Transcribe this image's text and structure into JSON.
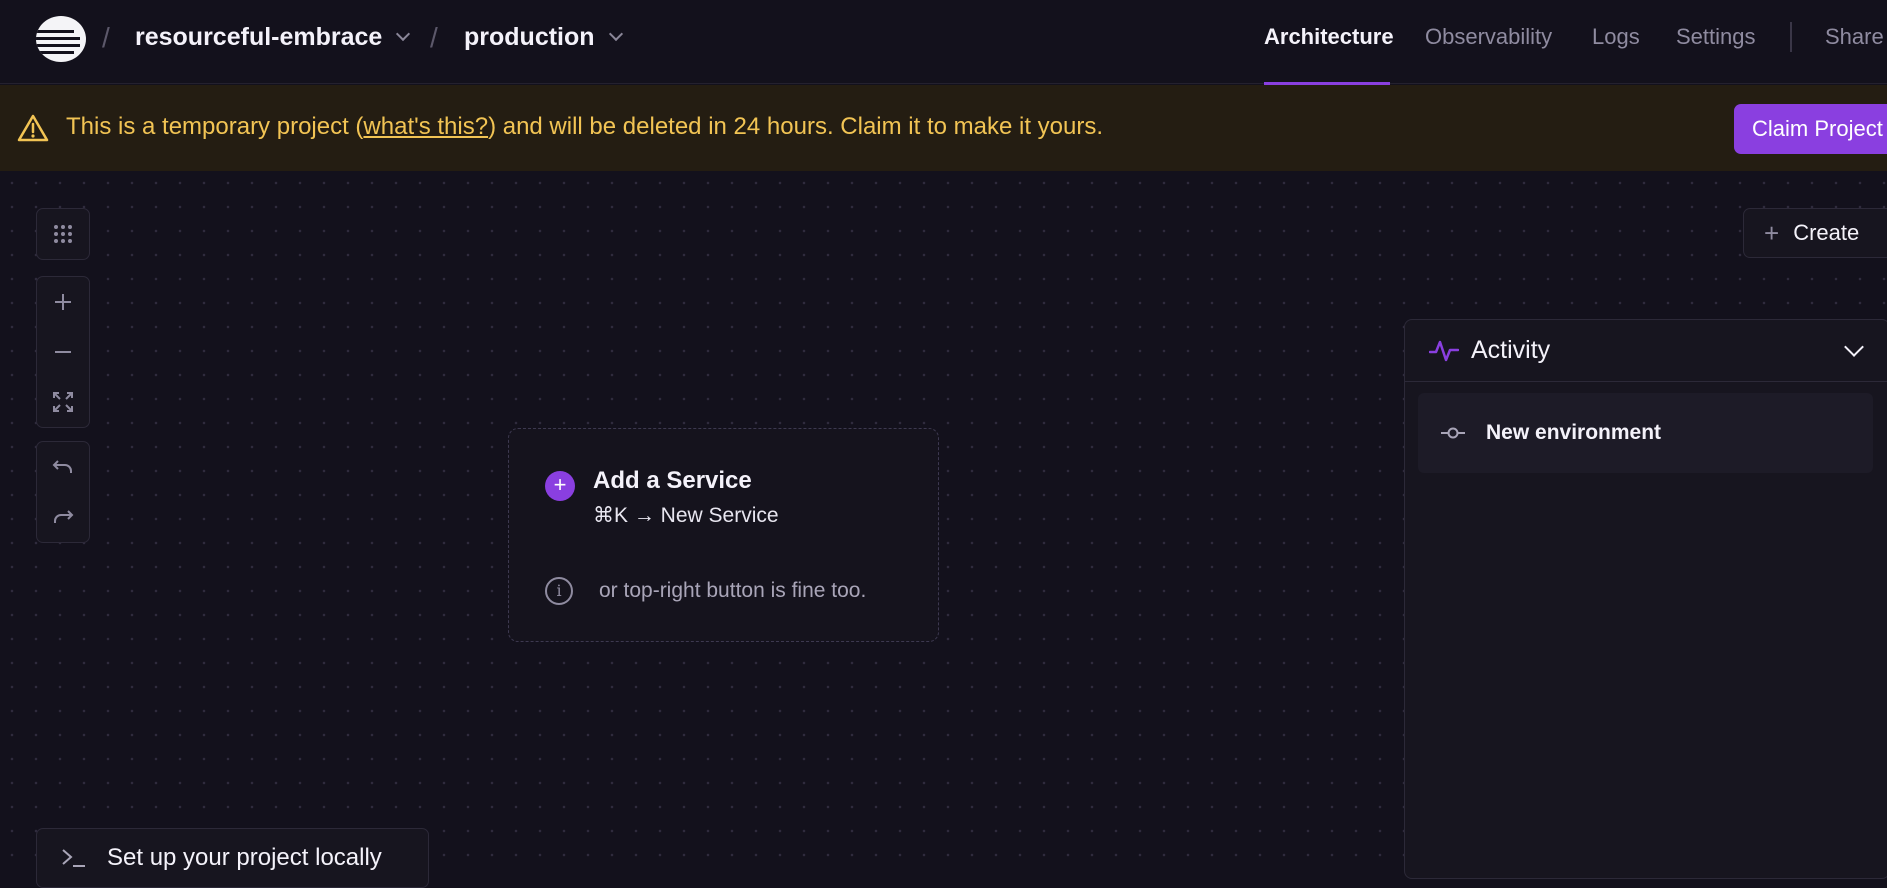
{
  "header": {
    "project_name": "resourceful-embrace",
    "environment": "production",
    "crumb_separator": "/",
    "nav": [
      {
        "label": "Architecture",
        "active": true
      },
      {
        "label": "Observability",
        "active": false
      },
      {
        "label": "Logs",
        "active": false
      },
      {
        "label": "Settings",
        "active": false
      },
      {
        "label": "Share",
        "active": false
      }
    ]
  },
  "banner": {
    "text_before": "This is a temporary project (",
    "link": "what's this?",
    "text_after": ") and will be deleted in 24 hours. Claim it to make it yours.",
    "claim_label": "Claim Project"
  },
  "canvas": {
    "create_label": "Create",
    "service_card": {
      "title": "Add a Service",
      "shortcut": "⌘K → New Service",
      "hint": "or top-right button is fine too."
    },
    "setup_label": "Set up your project locally"
  },
  "activity": {
    "title": "Activity",
    "items": [
      {
        "label": "New environment"
      }
    ]
  },
  "colors": {
    "background": "#13111c",
    "accent": "#8a3fe0",
    "warning": "#f2c454",
    "banner_bg": "#241d12"
  }
}
